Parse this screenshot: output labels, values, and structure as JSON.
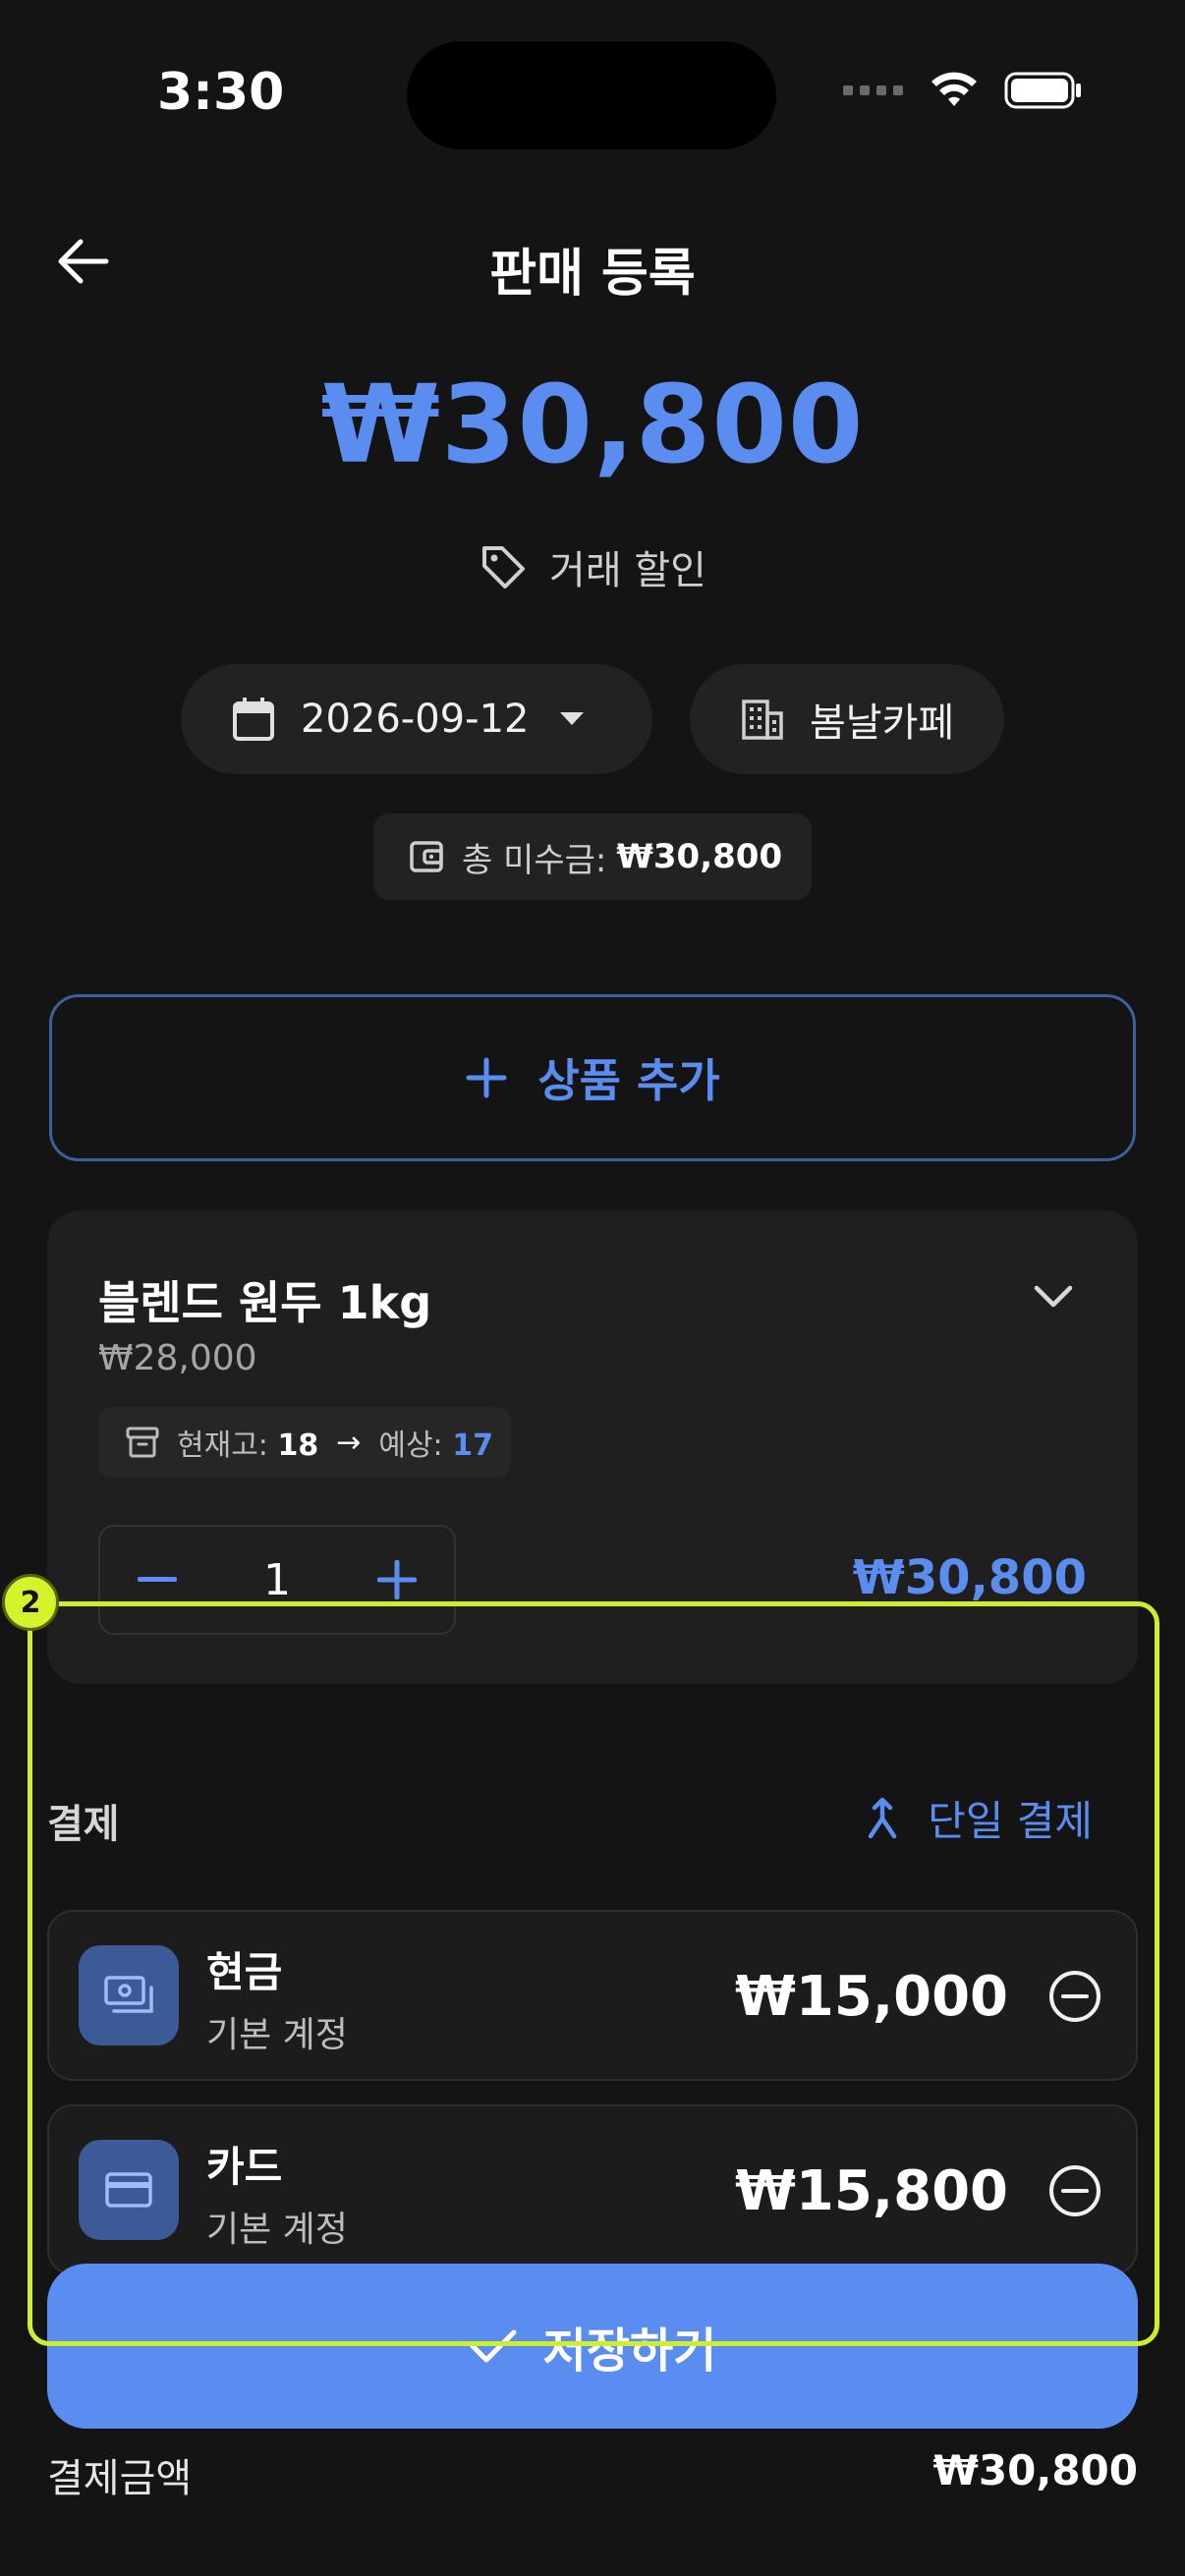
{
  "status_bar": {
    "time": "3:30"
  },
  "header": {
    "title": "판매 등록"
  },
  "summary": {
    "total": "₩30,800",
    "discount_label": "거래 할인",
    "date": "2026-09-12",
    "shop": "봄날카페",
    "debt_label": "총 미수금:",
    "debt_value": "₩30,800"
  },
  "add_product": {
    "label": "상품 추가"
  },
  "product": {
    "name": "블렌드 원두 1kg",
    "unit_price": "₩28,000",
    "stock_label": "현재고:",
    "stock_value": "18",
    "arrow": "→",
    "expected_label": "예상:",
    "expected_value": "17",
    "quantity": "1",
    "line_total": "₩30,800"
  },
  "payment": {
    "section_title": "결제",
    "single_pay_label": "단일 결제",
    "methods": [
      {
        "name": "현금",
        "account": "기본 계정",
        "amount": "₩15,000"
      },
      {
        "name": "카드",
        "account": "기본 계정",
        "amount": "₩15,800"
      }
    ]
  },
  "save": {
    "label": "저장하기"
  },
  "footer": {
    "label": "결제금액",
    "value": "₩30,800"
  },
  "overlay": {
    "badge": "2",
    "color": "#cdf02a"
  },
  "colors": {
    "accent": "#5b8cf0",
    "background": "#141414",
    "card": "#1f1f1f"
  }
}
